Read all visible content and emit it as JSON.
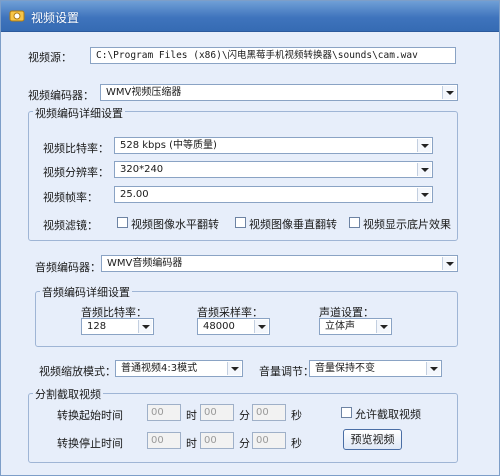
{
  "window": {
    "title": "视频设置"
  },
  "source": {
    "label": "视频源：",
    "path": "C:\\Program Files (x86)\\闪电黑莓手机视频转换器\\sounds\\cam.wav"
  },
  "video_encoder": {
    "label": "视频编码器：",
    "value": "WMV视频压缩器"
  },
  "video_detail": {
    "title": "视频编码详细设置",
    "bitrate": {
      "label": "视频比特率：",
      "value": "528 kbps (中等质量)"
    },
    "resolution": {
      "label": "视频分辨率：",
      "value": "320*240"
    },
    "framerate": {
      "label": "视频帧率：",
      "value": "25.00"
    },
    "filter": {
      "label": "视频滤镜：",
      "options": [
        "视频图像水平翻转",
        "视频图像垂直翻转",
        "视频显示底片效果"
      ]
    }
  },
  "audio_encoder": {
    "label": "音频编码器：",
    "value": "WMV音频编码器"
  },
  "audio_detail": {
    "title": "音频编码详细设置",
    "bitrate": {
      "label": "音频比特率：",
      "value": "128"
    },
    "samplerate": {
      "label": "音频采样率：",
      "value": "48000"
    },
    "channels": {
      "label": "声道设置：",
      "value": "立体声"
    }
  },
  "scale_mode": {
    "label": "视频缩放模式：",
    "value": "普通视频4:3模式"
  },
  "volume": {
    "label": "音量调节：",
    "value": "音量保持不变"
  },
  "split": {
    "title": "分割截取视频",
    "start_label": "转换起始时间",
    "stop_label": "转换停止时间",
    "unit_hour": "时",
    "unit_min": "分",
    "unit_sec": "秒",
    "start": {
      "h": "00",
      "m": "00",
      "s": "00"
    },
    "stop": {
      "h": "00",
      "m": "00",
      "s": "00"
    },
    "allow_label": "允许截取视频",
    "preview_button": "预览视频"
  }
}
